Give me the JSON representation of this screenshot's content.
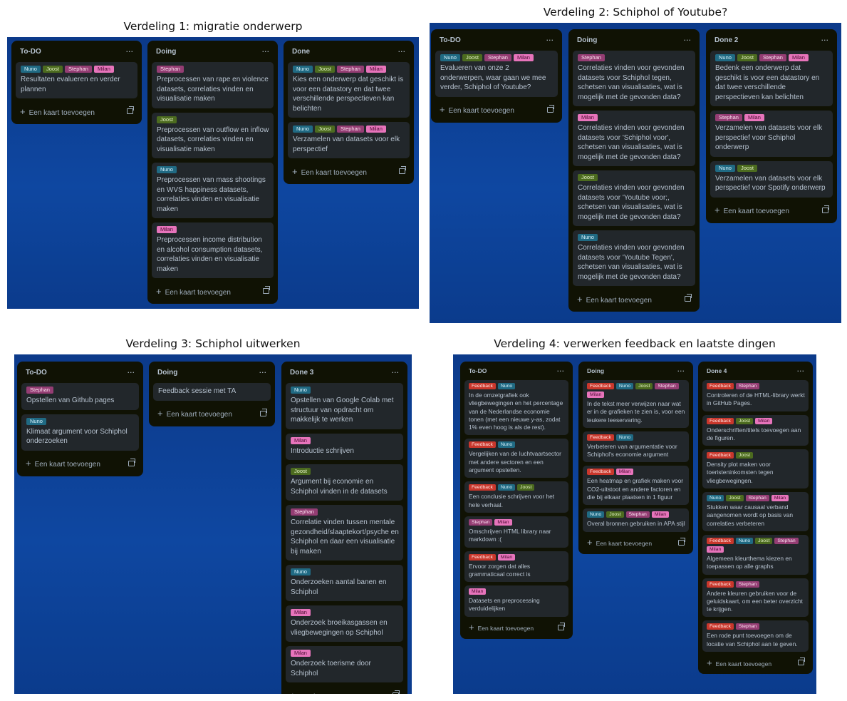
{
  "ui": {
    "add_card": "Een kaart toevoegen",
    "menu": "···",
    "plus": "+"
  },
  "panels": [
    {
      "title": "Verdeling 1: migratie onderwerp",
      "lists": [
        {
          "title": "To-DO",
          "cards": [
            {
              "labels": [
                "Nuno",
                "Joost",
                "Stephan",
                "Milan"
              ],
              "text": "Resultaten evalueren en verder plannen"
            }
          ]
        },
        {
          "title": "Doing",
          "cards": [
            {
              "labels": [
                "Stephan"
              ],
              "text": "Preprocessen van rape en violence datasets, correlaties vinden en visualisatie maken"
            },
            {
              "labels": [
                "Joost"
              ],
              "text": "Preprocessen van outflow en inflow datasets, correlaties vinden en visualisatie maken"
            },
            {
              "labels": [
                "Nuno"
              ],
              "text": "Preprocessen van mass shootings en WVS happiness datasets, correlaties vinden en visualisatie maken"
            },
            {
              "labels": [
                "Milan"
              ],
              "text": "Preprocessen income distribution en alcohol consumption datasets, correlaties vinden en visualisatie maken"
            }
          ]
        },
        {
          "title": "Done",
          "cards": [
            {
              "labels": [
                "Nuno",
                "Joost",
                "Stephan",
                "Milan"
              ],
              "text": "Kies een onderwerp dat geschikt is voor een datastory en dat twee verschillende perspectieven kan belichten"
            },
            {
              "labels": [
                "Nuno",
                "Joost",
                "Stephan",
                "Milan"
              ],
              "text": "Verzamelen van datasets voor elk perspectief"
            }
          ]
        }
      ]
    },
    {
      "title": "Verdeling 2: Schiphol of Youtube?",
      "lists": [
        {
          "title": "To-DO",
          "cards": [
            {
              "labels": [
                "Nuno",
                "Joost",
                "Stephan",
                "Milan"
              ],
              "text": "Evalueren van onze 2 onderwerpen, waar gaan we mee verder, Schiphol of Youtube?"
            }
          ]
        },
        {
          "title": "Doing",
          "cards": [
            {
              "labels": [
                "Stephan"
              ],
              "text": "Correlaties vinden voor gevonden datasets voor Schiphol tegen, schetsen van visualisaties, wat is mogelijk met de gevonden data?"
            },
            {
              "labels": [
                "Milan"
              ],
              "text": "Correlaties vinden voor gevonden datasets voor 'Schiphol voor', schetsen van visualisaties, wat is mogelijk met de gevonden data?"
            },
            {
              "labels": [
                "Joost"
              ],
              "text": "Correlaties vinden voor gevonden datasets voor 'Youtube voor;, schetsen van visualisaties, wat is mogelijk met de gevonden data?"
            },
            {
              "labels": [
                "Nuno"
              ],
              "text": "Correlaties vinden voor gevonden datasets voor 'Youtube Tegen', schetsen van visualisaties, wat is mogelijk met de gevonden data?"
            }
          ]
        },
        {
          "title": "Done 2",
          "cards": [
            {
              "labels": [
                "Nuno",
                "Joost",
                "Stephan",
                "Milan"
              ],
              "text": "Bedenk een onderwerp dat geschikt is voor een datastory en dat twee verschillende perspectieven kan belichten"
            },
            {
              "labels": [
                "Stephan",
                "Milan"
              ],
              "text": "Verzamelen van datasets voor elk perspectief voor Schiphol onderwerp"
            },
            {
              "labels": [
                "Nuno",
                "Joost"
              ],
              "text": "Verzamelen van datasets voor elk perspectief voor Spotify onderwerp"
            }
          ]
        }
      ]
    },
    {
      "title": "Verdeling 3: Schiphol uitwerken",
      "lists": [
        {
          "title": "To-DO",
          "cards": [
            {
              "labels": [
                "Stephan"
              ],
              "text": "Opstellen van Github pages"
            },
            {
              "labels": [
                "Nuno"
              ],
              "text": "Klimaat argument voor Schiphol onderzoeken"
            }
          ]
        },
        {
          "title": "Doing",
          "cards": [
            {
              "labels": [],
              "text": "Feedback sessie met TA"
            }
          ]
        },
        {
          "title": "Done 3",
          "cards": [
            {
              "labels": [
                "Nuno"
              ],
              "text": "Opstellen van Google Colab met structuur van opdracht om makkelijk te werken"
            },
            {
              "labels": [
                "Milan"
              ],
              "text": "Introductie schrijven"
            },
            {
              "labels": [
                "Joost"
              ],
              "text": "Argument bij economie en Schiphol vinden in de datasets"
            },
            {
              "labels": [
                "Stephan"
              ],
              "text": "Correlatie vinden tussen mentale gezondheid/slaaptekort/psyche en Schiphol en daar een visualisatie bij maken"
            },
            {
              "labels": [
                "Nuno"
              ],
              "text": "Onderzoeken aantal banen en Schiphol"
            },
            {
              "labels": [
                "Milan"
              ],
              "text": "Onderzoek broeikasgassen en vliegbewegingen op Schiphol"
            },
            {
              "labels": [
                "Milan"
              ],
              "text": "Onderzoek toerisme door Schiphol"
            }
          ]
        }
      ]
    },
    {
      "title": "Verdeling 4: verwerken feedback en laatste dingen",
      "lists": [
        {
          "title": "To-DO",
          "cards": [
            {
              "labels": [
                "Feedback",
                "Nuno"
              ],
              "text": "In de omzetgrafiek ook vliegbewegingen en het percentage van de Nederlandse economie tonen (met een nieuwe y-as, zodat 1% even hoog is als de rest)."
            },
            {
              "labels": [
                "Feedback",
                "Nuno"
              ],
              "text": "Vergelijken van de luchtvaartsector met andere sectoren en een argument opstellen."
            },
            {
              "labels": [
                "Feedback",
                "Nuno",
                "Joost"
              ],
              "text": "Een conclusie schrijven voor het hele verhaal."
            },
            {
              "labels": [
                "Stephan",
                "Milan"
              ],
              "text": "Omschrijven HTML library naar markdown :("
            },
            {
              "labels": [
                "Feedback",
                "Milan"
              ],
              "text": "Ervoor zorgen dat alles grammaticaal correct is"
            },
            {
              "labels": [
                "Milan"
              ],
              "text": "Datasets en preprocessing verduidelijken"
            }
          ]
        },
        {
          "title": "Doing",
          "cards": [
            {
              "labels": [
                "Feedback",
                "Nuno",
                "Joost",
                "Stephan",
                "Milan"
              ],
              "text": "In de tekst meer verwijzen naar wat er in de grafieken te zien is, voor een leukere leeservaring."
            },
            {
              "labels": [
                "Feedback",
                "Nuno"
              ],
              "text": "Verbeteren van argumentatie voor Schiphol's economie argument"
            },
            {
              "labels": [
                "Feedback",
                "Milan"
              ],
              "text": "Een heatmap en grafiek maken voor CO2-uitstoot en andere factoren en die bij elkaar plaatsen in 1 figuur"
            },
            {
              "labels": [
                "Nuno",
                "Joost",
                "Stephan",
                "Milan"
              ],
              "text": "Overal bronnen gebruiken in APA stijl"
            }
          ]
        },
        {
          "title": "Done 4",
          "cards": [
            {
              "labels": [
                "Feedback",
                "Stephan"
              ],
              "text": "Controleren of de HTML-library werkt in GitHub Pages."
            },
            {
              "labels": [
                "Feedback",
                "Joost",
                "Milan"
              ],
              "text": "Onderschriften/titels toevoegen aan de figuren."
            },
            {
              "labels": [
                "Feedback",
                "Joost"
              ],
              "text": "Density plot maken voor toeristeninkomsten tegen vliegbewegingen."
            },
            {
              "labels": [
                "Nuno",
                "Joost",
                "Stephan",
                "Milan"
              ],
              "text": "Stukken waar causaal verband aangenomen wordt op basis van correlaties verbeteren"
            },
            {
              "labels": [
                "Feedback",
                "Nuno",
                "Joost",
                "Stephan",
                "Milan"
              ],
              "text": "Algemeen kleurthema kiezen en toepassen op alle graphs"
            },
            {
              "labels": [
                "Feedback",
                "Stephan"
              ],
              "text": "Andere kleuren gebruiken voor de geluidskaart, om een beter overzicht te krijgen."
            },
            {
              "labels": [
                "Feedback",
                "Stephan"
              ],
              "text": "Een rode punt toevoegen om de locatie van Schiphol aan te geven."
            }
          ]
        }
      ]
    }
  ]
}
